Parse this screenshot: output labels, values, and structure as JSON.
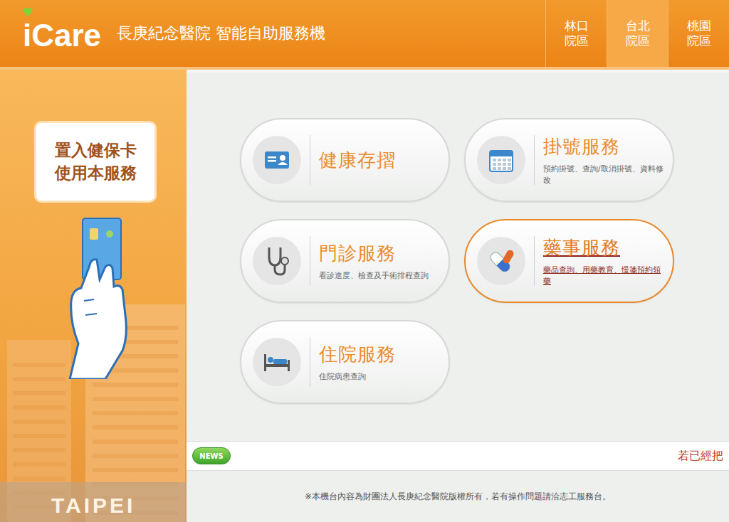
{
  "header": {
    "logo": "iCare",
    "title": "長庚紀念醫院 智能自助服務機"
  },
  "campus_tabs": [
    {
      "label": "林口院區",
      "selected": false
    },
    {
      "label": "台北院區",
      "selected": true
    },
    {
      "label": "桃園院區",
      "selected": false
    }
  ],
  "card_prompt": {
    "lines": [
      "置入健保卡",
      "使用本服務"
    ]
  },
  "city_label": "TAIPEI",
  "menu": [
    {
      "kind": "card",
      "title": "健康存摺",
      "subtitle": "",
      "selected": false
    },
    {
      "kind": "calendar",
      "title": "掛號服務",
      "subtitle": "預約掛號、查詢/取消掛號、資料修改",
      "selected": false
    },
    {
      "kind": "stethoscope",
      "title": "門診服務",
      "subtitle": "看診進度、檢查及手術排程查詢",
      "selected": false
    },
    {
      "kind": "pills",
      "title": "藥事服務",
      "subtitle": "藥品查詢、用藥教育、慢箋預約領藥",
      "selected": true
    },
    {
      "kind": "bed",
      "title": "住院服務",
      "subtitle": "住院病患查詢",
      "selected": false
    }
  ],
  "news": {
    "badge": "NEWS",
    "ticker": "若已經把"
  },
  "footer": "※本機台內容為財團法人長庚紀念醫院版權所有，若有操作問題請洽志工服務台。"
}
